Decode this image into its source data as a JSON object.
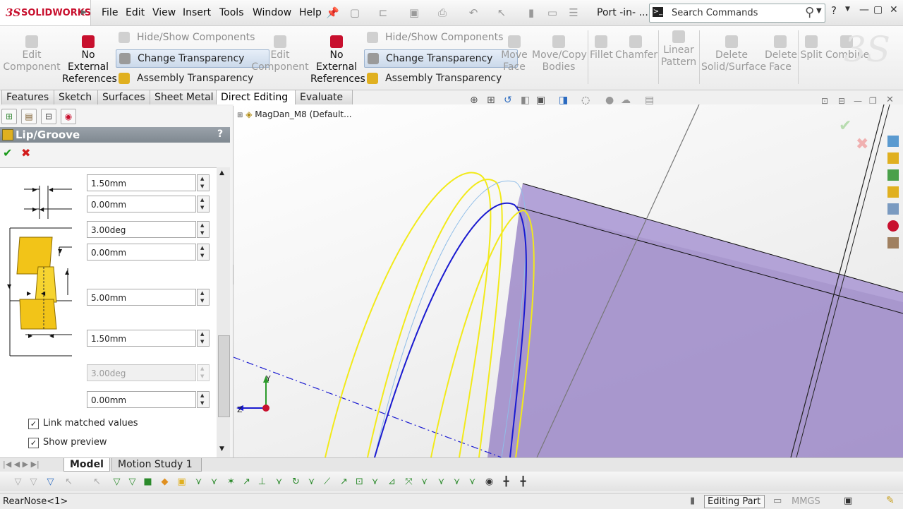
{
  "app": {
    "logo_ds": "3S",
    "logo_name": "SOLIDWORKS"
  },
  "menu": [
    "File",
    "Edit",
    "View",
    "Insert",
    "Tools",
    "Window",
    "Help"
  ],
  "document_title": "Port -in- ...",
  "search": {
    "placeholder": "Search Commands"
  },
  "command_manager": {
    "group1": {
      "edit_component": "Edit\nComponent",
      "no_external_refs": "No\nExternal\nReferences",
      "hide_show": "Hide/Show Components",
      "change_transparency": "Change Transparency",
      "assembly_transparency": "Assembly Transparency"
    },
    "group2": {
      "edit_component": "Edit\nComponent",
      "no_external_refs": "No\nExternal\nReferences",
      "hide_show": "Hide/Show Components",
      "change_transparency": "Change Transparency",
      "assembly_transparency": "Assembly Transparency"
    },
    "tools": {
      "move_face": "Move\nFace",
      "move_copy": "Move/Copy\nBodies",
      "fillet": "Fillet",
      "chamfer": "Chamfer",
      "linear_pattern": "Linear\nPattern",
      "delete_solid": "Delete\nSolid/Surface",
      "delete_face": "Delete\nFace",
      "split": "Split",
      "combine": "Combine"
    }
  },
  "tabs": [
    "Features",
    "Sketch",
    "Surfaces",
    "Sheet Metal",
    "Direct Editing",
    "Evaluate"
  ],
  "active_tab": "Direct Editing",
  "property_manager": {
    "title": "Lip/Groove",
    "help": "?",
    "ok": "✔",
    "cancel": "✖",
    "fields": [
      {
        "value": "1.50mm",
        "disabled": false
      },
      {
        "value": "0.00mm",
        "disabled": false
      },
      {
        "value": "3.00deg",
        "disabled": false
      },
      {
        "value": "0.00mm",
        "disabled": false
      },
      {
        "value": "5.00mm",
        "disabled": false
      },
      {
        "value": "1.50mm",
        "disabled": false
      },
      {
        "value": "3.00deg",
        "disabled": true
      },
      {
        "value": "0.00mm",
        "disabled": false
      }
    ],
    "link_matched_values": "Link matched values",
    "show_preview": "Show preview"
  },
  "feature_tree": {
    "root": "MagDan_M8  (Default..."
  },
  "triad": {
    "y": "Y",
    "z": "Z"
  },
  "bottom_tabs": [
    "Model",
    "Motion Study 1"
  ],
  "status": {
    "left": "RearNose<1>",
    "editing": "Editing Part",
    "units": "MMGS"
  },
  "colors": {
    "accent": "#c8102e",
    "body": "#9c88c8",
    "preview": "#f2ea1a",
    "edge": "#1a1ad0"
  }
}
